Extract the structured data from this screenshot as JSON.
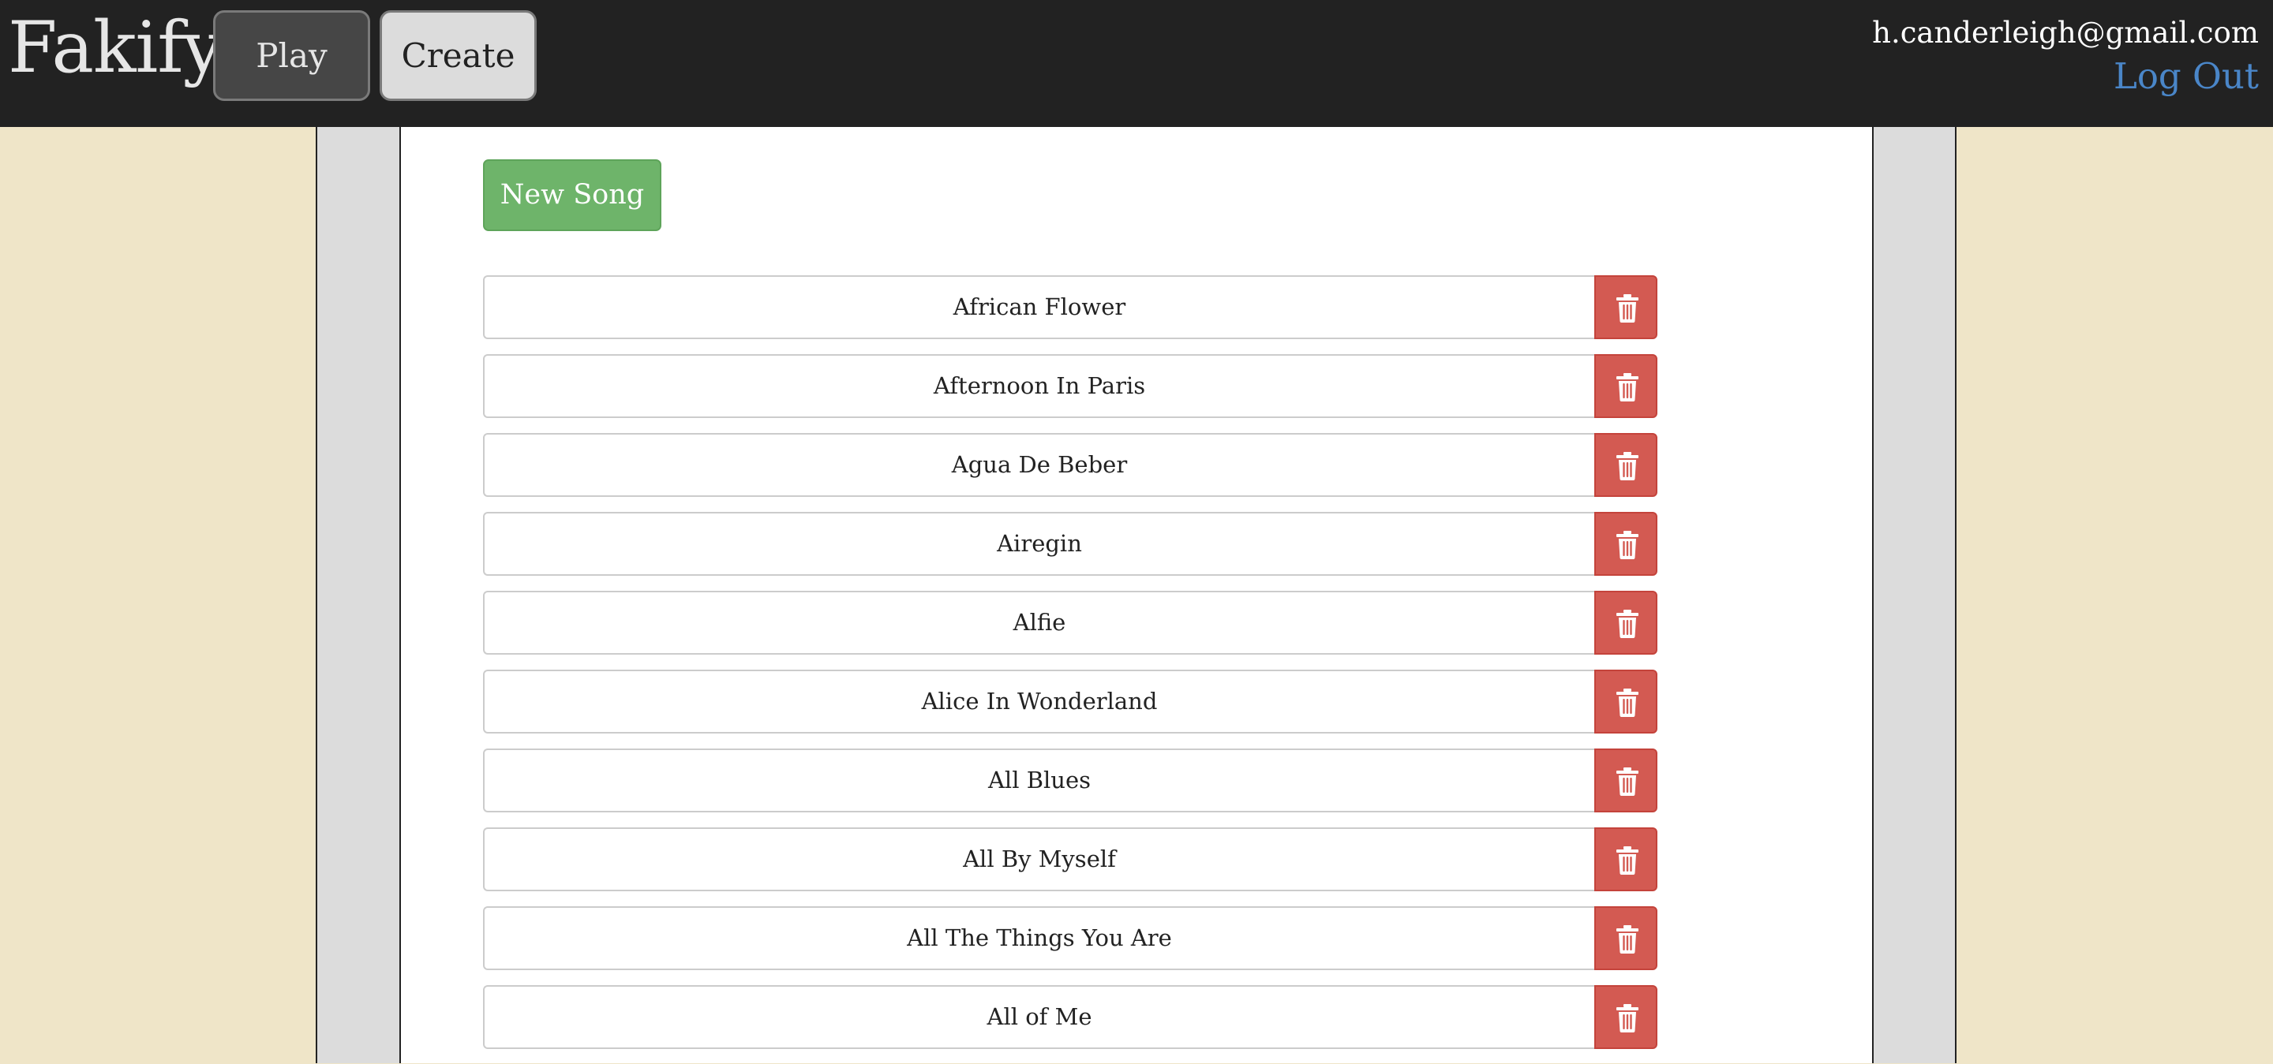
{
  "header": {
    "brand": "Fakify",
    "nav": {
      "play_label": "Play",
      "create_label": "Create"
    },
    "user_email": "h.canderleigh@gmail.com",
    "logout_label": "Log Out"
  },
  "main": {
    "new_song_label": "New Song",
    "songs": [
      {
        "title": "African Flower",
        "delete_icon": "trash-icon"
      },
      {
        "title": "Afternoon In Paris",
        "delete_icon": "trash-icon"
      },
      {
        "title": "Agua De Beber",
        "delete_icon": "trash-icon"
      },
      {
        "title": "Airegin",
        "delete_icon": "trash-icon"
      },
      {
        "title": "Alfie",
        "delete_icon": "trash-icon"
      },
      {
        "title": "Alice In Wonderland",
        "delete_icon": "trash-icon"
      },
      {
        "title": "All Blues",
        "delete_icon": "trash-icon"
      },
      {
        "title": "All By Myself",
        "delete_icon": "trash-icon"
      },
      {
        "title": "All The Things You Are",
        "delete_icon": "trash-icon"
      },
      {
        "title": "All of Me",
        "delete_icon": "trash-icon"
      }
    ]
  },
  "colors": {
    "page_background": "#efe5c8",
    "header_background": "#222222",
    "new_song_green": "#6eb46a",
    "delete_red": "#d35a52",
    "link_blue": "#4a86c8"
  }
}
